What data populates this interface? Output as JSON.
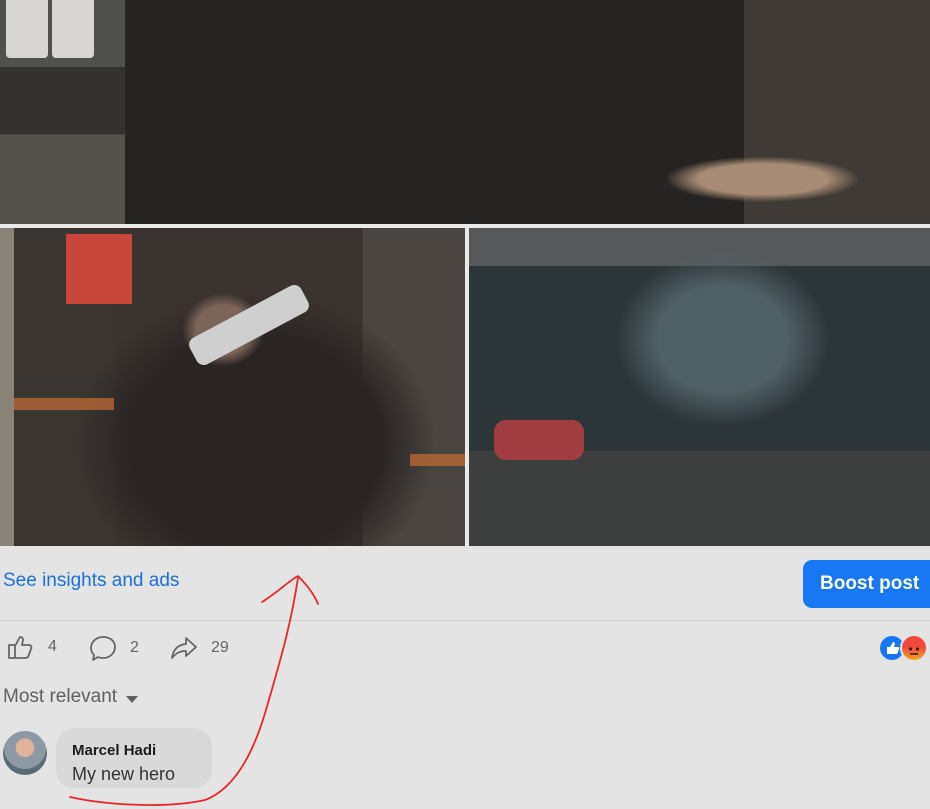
{
  "post": {
    "media": [
      {
        "description_icon": "photo-icon"
      },
      {
        "description_icon": "photo-icon"
      },
      {
        "description_icon": "photo-icon"
      }
    ]
  },
  "actions": {
    "insights_link": "See insights and ads",
    "boost_label": "Boost post"
  },
  "stats": {
    "likes": "4",
    "comments": "2",
    "shares": "29",
    "reaction_icons": [
      "like-reaction-icon",
      "angry-reaction-icon"
    ]
  },
  "comments": {
    "sort_label": "Most relevant",
    "items": [
      {
        "author": "Marcel Hadi",
        "text": "My new hero"
      }
    ]
  },
  "colors": {
    "link": "#1b6fd8",
    "boost_bg": "#1877f2",
    "annotation": "#e8262a"
  }
}
